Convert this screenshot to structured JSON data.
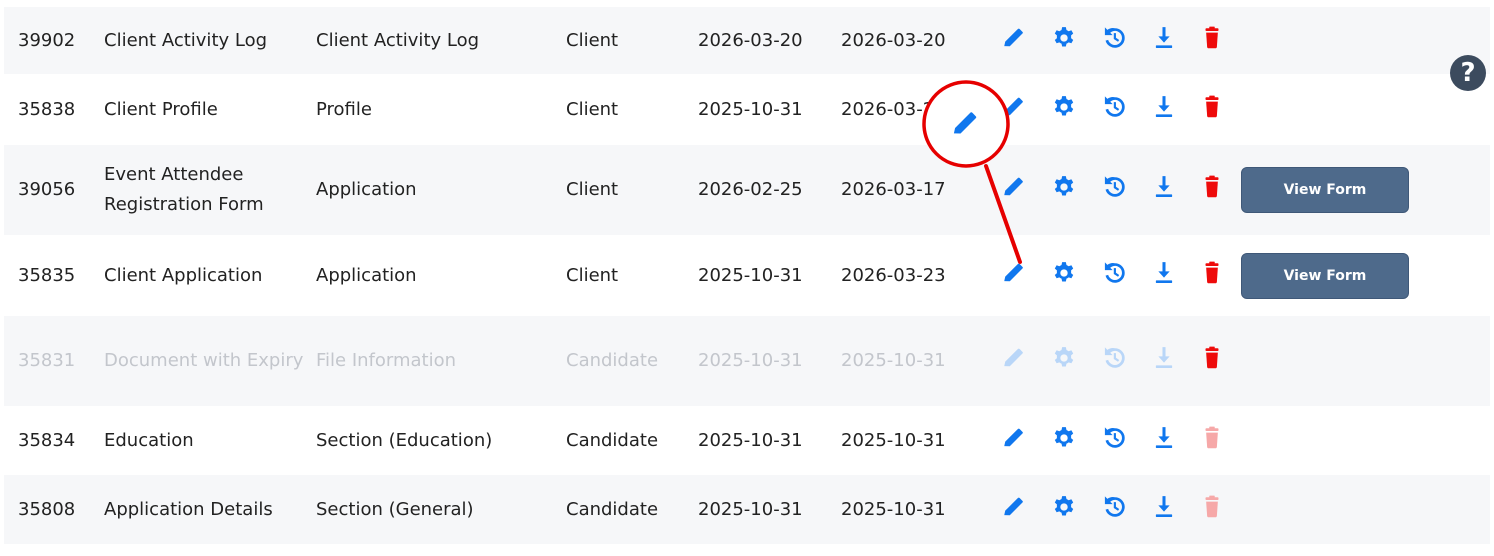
{
  "colors": {
    "icon_blue": "#1077ee",
    "icon_blue_disabled": "#b9d6f8",
    "delete_red": "#ee0b0b",
    "delete_red_disabled": "#f6a8a8",
    "button_bg": "#4e6a8b",
    "annotation_red": "#e60000"
  },
  "icons": {
    "edit": "pencil-icon",
    "settings": "gear-icon",
    "history": "history-icon",
    "download": "download-icon",
    "delete": "trash-icon",
    "help": "question-circle-icon"
  },
  "help": {
    "label": "?"
  },
  "rows": [
    {
      "id": "39902",
      "name": "Client Activity Log",
      "type": "Client Activity Log",
      "category": "Client",
      "created": "2026-03-20",
      "updated": "2026-03-20",
      "disabled": false,
      "delete_enabled": true,
      "view_form": null
    },
    {
      "id": "35838",
      "name": "Client Profile",
      "type": "Profile",
      "category": "Client",
      "created": "2025-10-31",
      "updated": "2026-03-2",
      "disabled": false,
      "delete_enabled": true,
      "view_form": null
    },
    {
      "id": "39056",
      "name": "Event Attendee Registration Form",
      "type": "Application",
      "category": "Client",
      "created": "2026-02-25",
      "updated": "2026-03-17",
      "disabled": false,
      "delete_enabled": true,
      "view_form": "View Form"
    },
    {
      "id": "35835",
      "name": "Client Application",
      "type": "Application",
      "category": "Client",
      "created": "2025-10-31",
      "updated": "2026-03-23",
      "disabled": false,
      "delete_enabled": true,
      "view_form": "View Form"
    },
    {
      "id": "35831",
      "name": "Document with Expiry",
      "type": "File Information",
      "category": "Candidate",
      "created": "2025-10-31",
      "updated": "2025-10-31",
      "disabled": true,
      "delete_enabled": true,
      "view_form": null
    },
    {
      "id": "35834",
      "name": "Education",
      "type": "Section (Education)",
      "category": "Candidate",
      "created": "2025-10-31",
      "updated": "2025-10-31",
      "disabled": false,
      "delete_enabled": false,
      "view_form": null
    },
    {
      "id": "35808",
      "name": "Application Details",
      "type": "Section (General)",
      "category": "Candidate",
      "created": "2025-10-31",
      "updated": "2025-10-31",
      "disabled": false,
      "delete_enabled": false,
      "view_form": null
    }
  ]
}
